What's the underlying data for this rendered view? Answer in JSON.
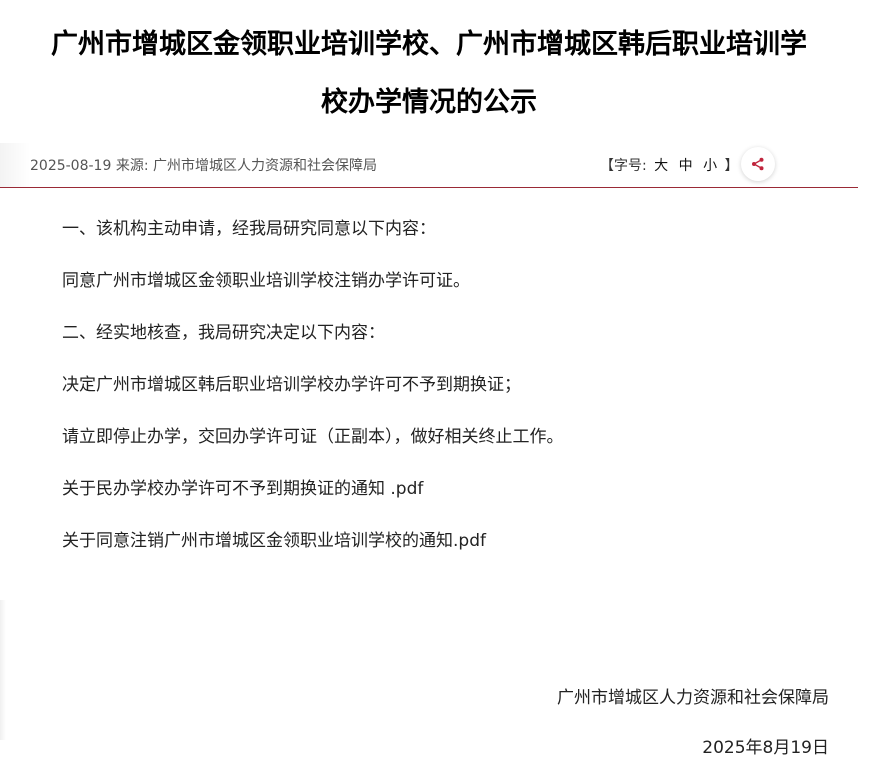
{
  "article": {
    "title_line1": "广州市增城区金领职业培训学校、广州市增城区韩后职业培训学",
    "title_line2": "校办学情况的公示",
    "date": "2025-08-19",
    "source_label": "来源:",
    "source": "广州市增城区人力资源和社会保障局",
    "font_size_label": "【字号:",
    "font_size_options": [
      "大",
      "中",
      "小"
    ],
    "font_size_end": "】",
    "share_icon": "share-icon",
    "paragraphs": [
      "一、该机构主动申请，经我局研究同意以下内容：",
      "同意广州市增城区金领职业培训学校注销办学许可证。",
      "二、经实地核查，我局研究决定以下内容：",
      "决定广州市增城区韩后职业培训学校办学许可不予到期换证；",
      "请立即停止办学，交回办学许可证（正副本），做好相关终止工作。"
    ],
    "attachments": [
      "关于民办学校办学许可不予到期换证的通知 .pdf",
      "关于同意注销广州市增城区金领职业培训学校的通知.pdf"
    ],
    "signature_org": "广州市增城区人力资源和社会保障局",
    "signature_date": "2025年8月19日"
  },
  "colors": {
    "accent": "#9a2a36",
    "share_icon": "#c0253d"
  }
}
